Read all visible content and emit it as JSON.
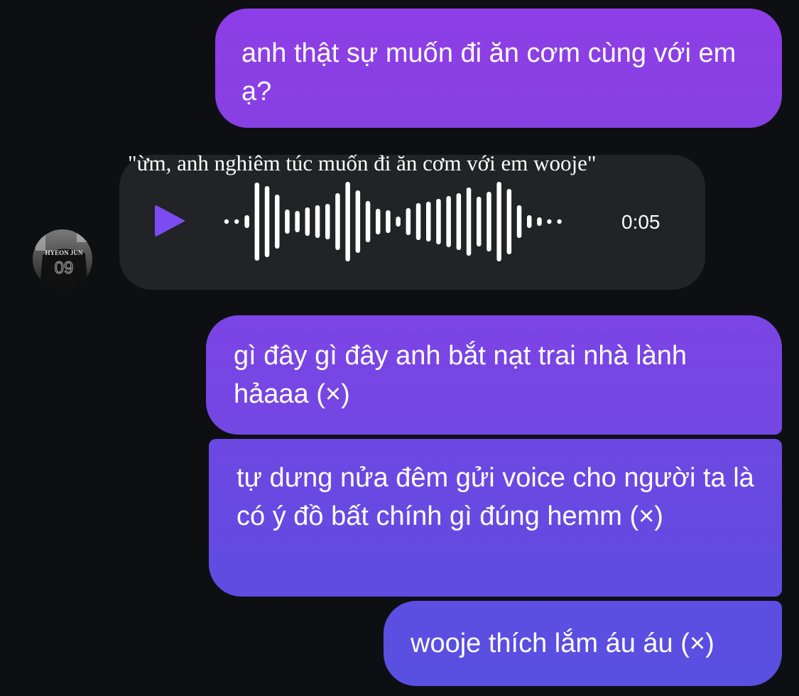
{
  "messages": [
    {
      "side": "outgoing",
      "text": "anh thật sự muốn đi ăn cơm cùng với em ạ?"
    },
    {
      "side": "incoming",
      "type": "voice",
      "caption": "\"ừm, anh nghiêm túc muốn đi ăn cơm với em wooje\"",
      "duration": "0:05"
    },
    {
      "side": "outgoing",
      "text": "gì đây gì đây anh bắt nạt trai nhà lành hảaaa (×)"
    },
    {
      "side": "outgoing",
      "text": "tự dưng nửa đêm gửi voice cho người ta là có ý đồ bất chính gì đúng hemm (×)"
    },
    {
      "side": "outgoing",
      "text": "wooje thích lắm áu áu (×)"
    }
  ],
  "avatar": {
    "jersey_name": "HYEON JUN",
    "jersey_number": "09"
  },
  "icons": {
    "play": "play-icon",
    "waveform": "waveform-icon"
  },
  "colors": {
    "background": "#0d0f13",
    "outgoing_top": "#8e3ee6",
    "outgoing_bottom": "#5850e0",
    "incoming_bubble": "#222326",
    "play_accent": "#7c4cf2"
  }
}
